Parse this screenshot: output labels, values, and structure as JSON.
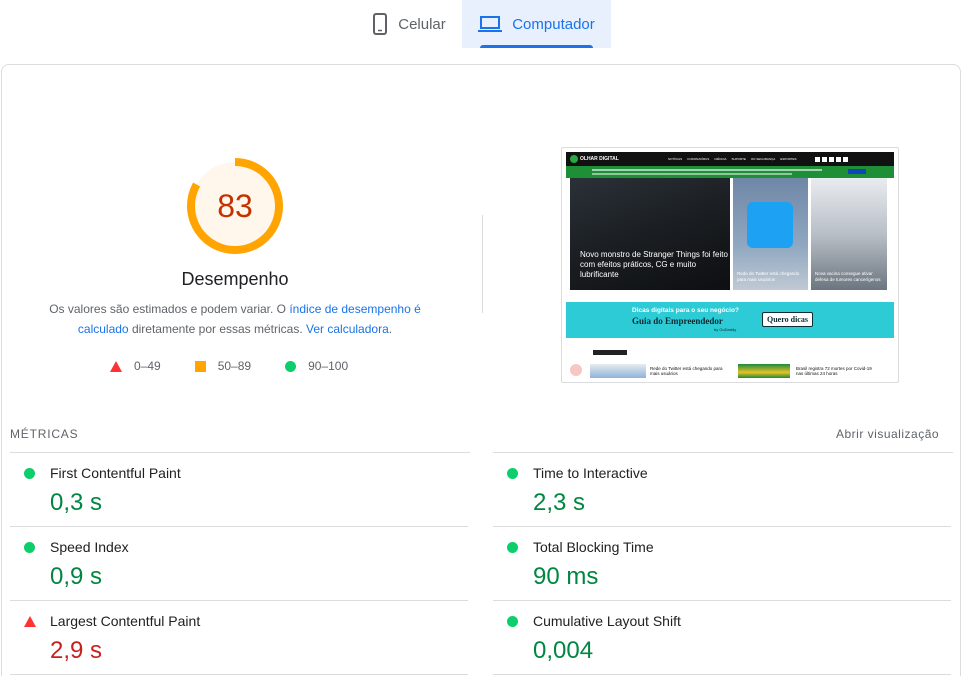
{
  "tabs": {
    "mobile": {
      "label": "Celular",
      "icon": "smartphone-icon",
      "selected": false
    },
    "desktop": {
      "label": "Computador",
      "icon": "laptop-icon",
      "selected": true
    }
  },
  "performance": {
    "score": "83",
    "score_fraction": 0.83,
    "score_color": "#ffa400",
    "title": "Desempenho",
    "desc_part1": "Os valores são estimados e podem variar. O",
    "desc_link1": "índice de desempenho é calculado",
    "desc_part2": "diretamente por essas métricas.",
    "desc_link2": "Ver calculadora",
    "desc_end": ".",
    "legend": [
      {
        "shape": "triangle",
        "color": "#ff3333",
        "range": "0–49"
      },
      {
        "shape": "square",
        "color": "#ffa400",
        "range": "50–89"
      },
      {
        "shape": "circle",
        "color": "#0cce6b",
        "range": "90–100"
      }
    ]
  },
  "screenshot": {
    "site_logo": "OLHAR DIGITAL",
    "menu": [
      "NOTÍCIAS",
      "CORONAVÍRUS",
      "CIÊNCIA",
      "SUPORTE",
      "OD SEGURANÇA",
      "ESPORTES"
    ],
    "hero_headline": "Novo monstro de Stranger Things foi feito com efeitos práticos, CG e muito lubrificante",
    "card2_headline": "Rede do Twitter está chegando para mais usuários",
    "card3_headline": "Nova vacina consegue ativar defesa de tumores cancerígenos",
    "ad_small": "Dicas digitais para o seu negócio?",
    "ad_big": "Guia do Empreendedor",
    "ad_brand": "by GoDaddy",
    "ad_button": "Quero dicas",
    "bottom_text1": "Rede do Twitter está chegando para mais usuários",
    "bottom_text2": "Brasil registra 72 mortes por Covid-19 nas últimas 24 horas"
  },
  "metrics": {
    "heading": "MÉTRICAS",
    "toggle_label": "Abrir visualização",
    "items": [
      {
        "label": "First Contentful Paint",
        "value": "0,3 s",
        "status": "good"
      },
      {
        "label": "Time to Interactive",
        "value": "2,3 s",
        "status": "good"
      },
      {
        "label": "Speed Index",
        "value": "0,9 s",
        "status": "good"
      },
      {
        "label": "Total Blocking Time",
        "value": "90 ms",
        "status": "good"
      },
      {
        "label": "Largest Contentful Paint",
        "value": "2,9 s",
        "status": "bad"
      },
      {
        "label": "Cumulative Layout Shift",
        "value": "0,004",
        "status": "good"
      }
    ]
  },
  "colors": {
    "accent": "#1a73e8",
    "good": "#0cce6b",
    "average": "#ffa400",
    "poor": "#ff3333"
  }
}
